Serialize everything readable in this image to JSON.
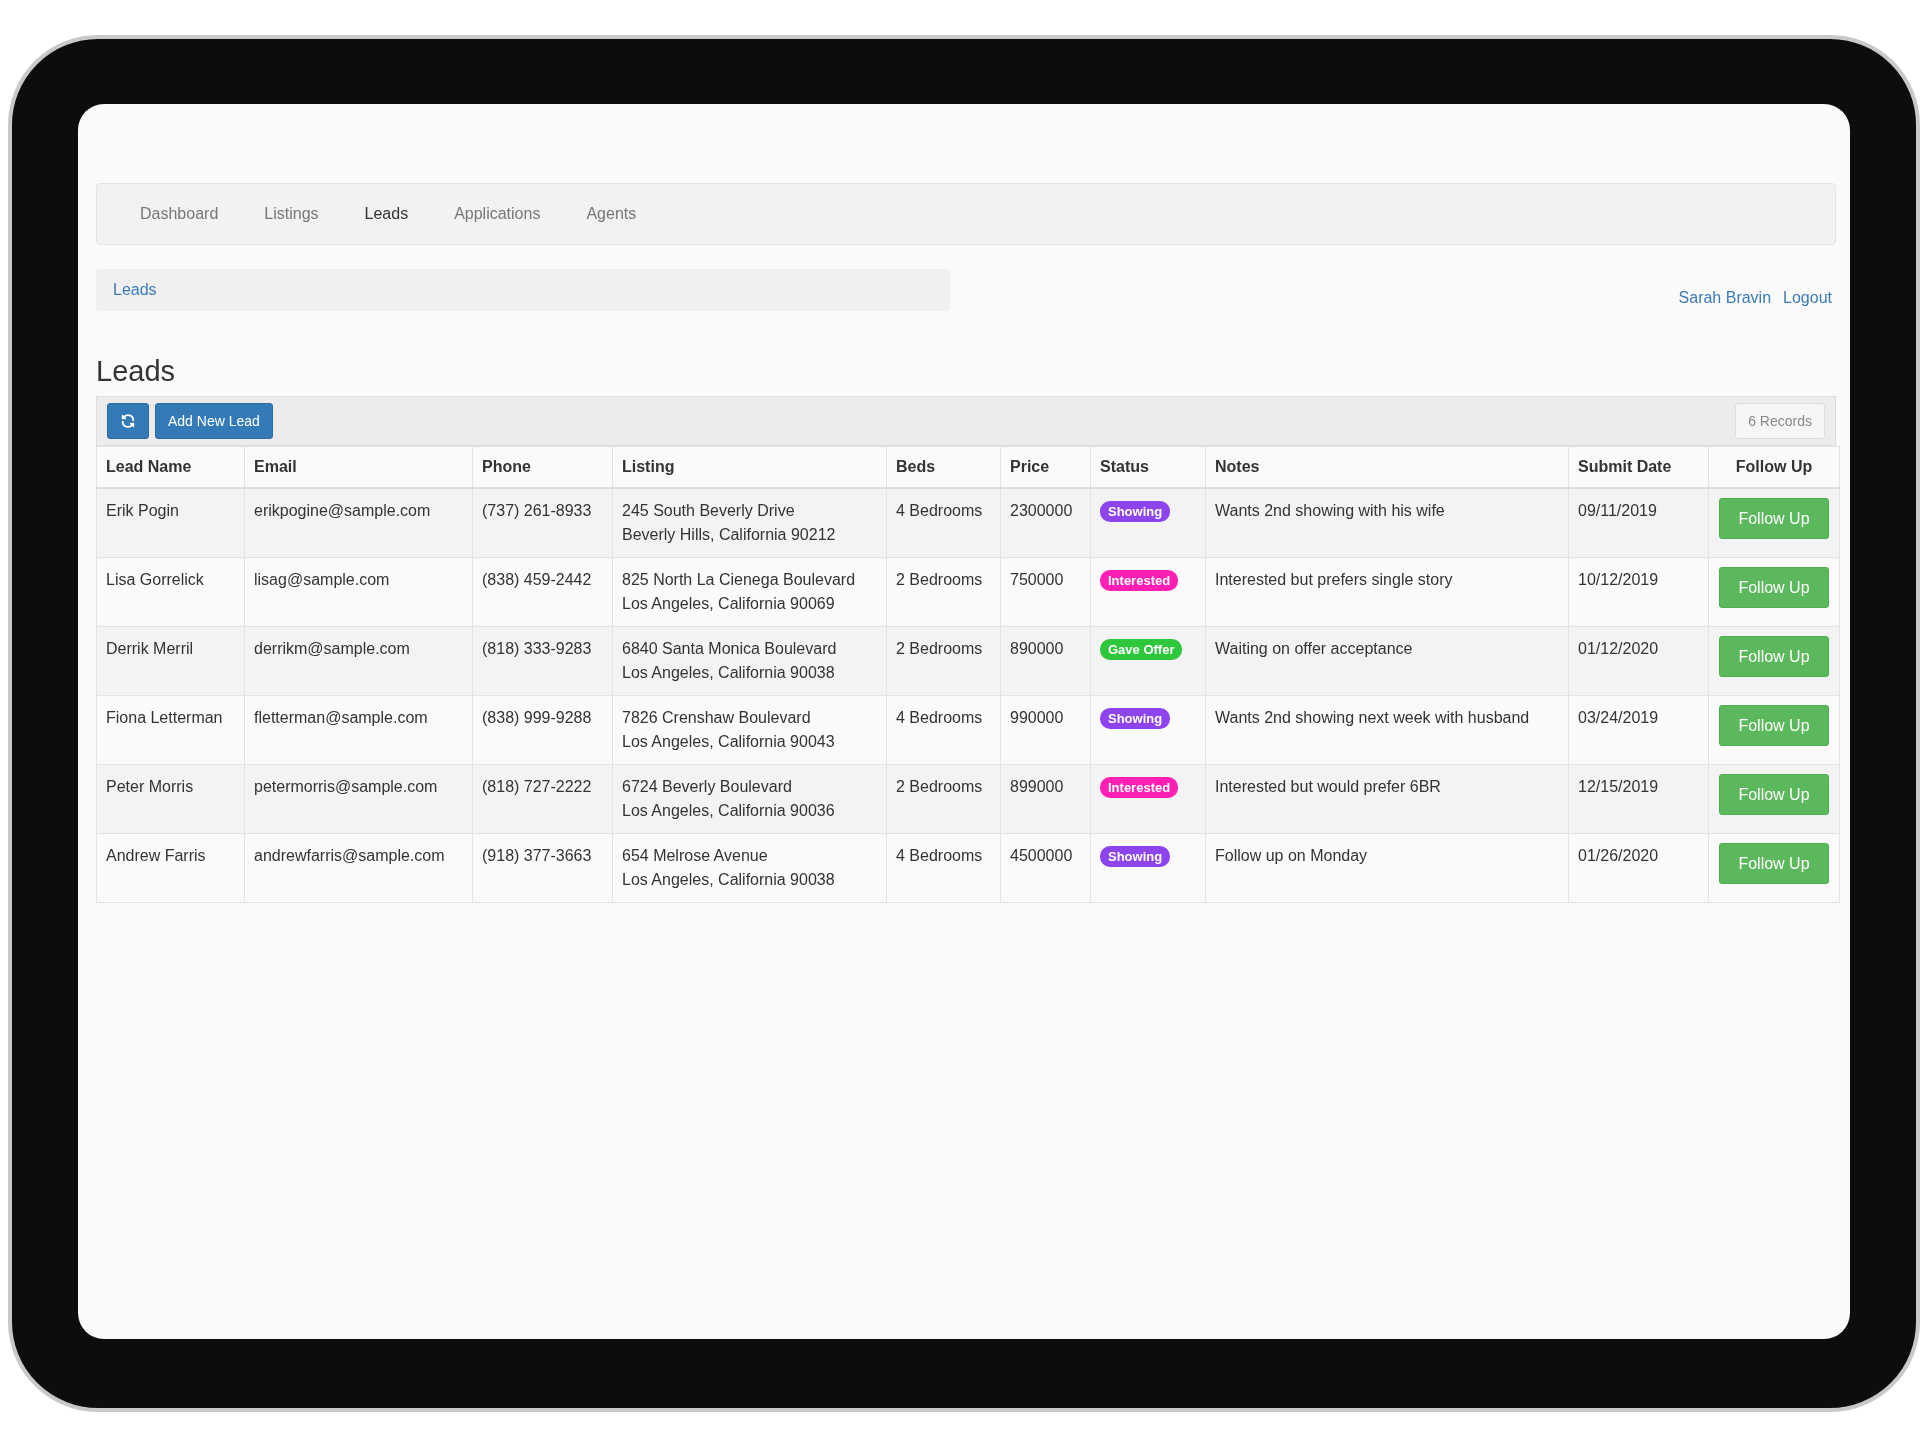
{
  "nav": {
    "items": [
      {
        "label": "Dashboard",
        "selected": false
      },
      {
        "label": "Listings",
        "selected": false
      },
      {
        "label": "Leads",
        "selected": true
      },
      {
        "label": "Applications",
        "selected": false
      },
      {
        "label": "Agents",
        "selected": false
      }
    ]
  },
  "breadcrumb": [
    "Leads"
  ],
  "user": {
    "name": "Sarah Bravin",
    "logout": "Logout"
  },
  "heading": "Leads",
  "toolbar": {
    "add_button": "Add New Lead",
    "record_count": "6 Records"
  },
  "table": {
    "columns": [
      "Lead Name",
      "Email",
      "Phone",
      "Listing",
      "Beds",
      "Price",
      "Status",
      "Notes",
      "Submit Date",
      "Follow Up"
    ],
    "rows": [
      {
        "name": "Erik Pogin",
        "email": "erikpogine@sample.com",
        "phone": "(737) 261-8933",
        "listing": [
          "245 South Beverly Drive",
          "Beverly Hills, California 90212"
        ],
        "beds": "4 Bedrooms",
        "price": "2300000",
        "status": {
          "label": "Showing",
          "color": "#8e44ec"
        },
        "notes": "Wants 2nd showing with his wife",
        "date": "09/11/2019",
        "action": "Follow Up"
      },
      {
        "name": "Lisa Gorrelick",
        "email": "lisag@sample.com",
        "phone": "(838) 459-2442",
        "listing": [
          "825 North La Cienega Boulevard",
          "Los Angeles, California 90069"
        ],
        "beds": "2 Bedrooms",
        "price": "750000",
        "status": {
          "label": "Interested",
          "color": "#ff1fb4"
        },
        "notes": "Interested but prefers single story",
        "date": "10/12/2019",
        "action": "Follow Up"
      },
      {
        "name": "Derrik Merril",
        "email": "derrikm@sample.com",
        "phone": "(818) 333-9283",
        "listing": [
          "6840 Santa Monica Boulevard",
          "Los Angeles, California 90038"
        ],
        "beds": "2 Bedrooms",
        "price": "890000",
        "status": {
          "label": "Gave Offer",
          "color": "#2ec73c"
        },
        "notes": "Waiting on offer acceptance",
        "date": "01/12/2020",
        "action": "Follow Up"
      },
      {
        "name": "Fiona Letterman",
        "email": "fletterman@sample.com",
        "phone": "(838) 999-9288",
        "listing": [
          "7826 Crenshaw Boulevard",
          "Los Angeles, California 90043"
        ],
        "beds": "4 Bedrooms",
        "price": "990000",
        "status": {
          "label": "Showing",
          "color": "#8e44ec"
        },
        "notes": "Wants 2nd showing next week with husband",
        "date": "03/24/2019",
        "action": "Follow Up"
      },
      {
        "name": "Peter Morris",
        "email": "petermorris@sample.com",
        "phone": "(818) 727-2222",
        "listing": [
          "6724 Beverly Boulevard",
          "Los Angeles, California 90036"
        ],
        "beds": "2 Bedrooms",
        "price": "899000",
        "status": {
          "label": "Interested",
          "color": "#ff1fb4"
        },
        "notes": "Interested but would prefer 6BR",
        "date": "12/15/2019",
        "action": "Follow Up"
      },
      {
        "name": "Andrew Farris",
        "email": "andrewfarris@sample.com",
        "phone": "(918) 377-3663",
        "listing": [
          "654 Melrose Avenue",
          "Los Angeles, California 90038"
        ],
        "beds": "4 Bedrooms",
        "price": "4500000",
        "status": {
          "label": "Showing",
          "color": "#8e44ec"
        },
        "notes": "Follow up on Monday",
        "date": "01/26/2020",
        "action": "Follow Up"
      }
    ]
  }
}
